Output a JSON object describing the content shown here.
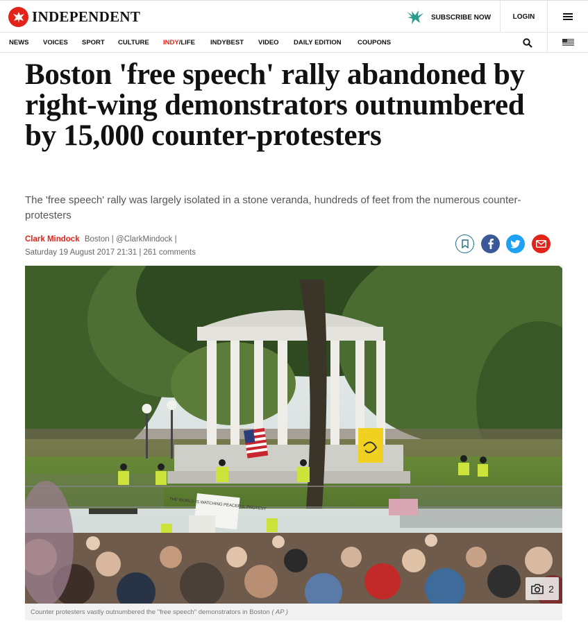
{
  "header": {
    "logo_text": "INDEPENDENT",
    "subscribe_label": "SUBSCRIBE NOW",
    "login_label": "LOGIN"
  },
  "nav": {
    "items": [
      "NEWS",
      "VOICES",
      "SPORT",
      "CULTURE",
      "INDY",
      "/LIFE",
      "INDYBEST",
      "VIDEO",
      "DAILY EDITION",
      "COUPONS"
    ]
  },
  "article": {
    "headline": "Boston 'free speech' rally abandoned by right-wing demonstrators outnumbered by 15,000 counter-protesters",
    "standfirst": "The 'free speech' rally was largely isolated in a stone veranda, hundreds of feet from the numerous counter-protesters",
    "author": "Clark Mindock",
    "location": "Boston |",
    "handle": "@ClarkMindock",
    "handle_sep": "|",
    "date": "Saturday 19 August 2017 21:31",
    "comments": "| 261 comments",
    "gallery_count": "2",
    "caption": "Counter protesters vastly outnumbered the \"free speech\" demonstrators in Boston",
    "caption_credit": "( AP )",
    "sign_text": "THE WORLD IS WATCHING PEACEFUL PROTEST"
  },
  "colors": {
    "brand_red": "#e2231a",
    "facebook": "#3b5998",
    "twitter": "#1da1f2",
    "bookmark": "#1b6d86"
  }
}
